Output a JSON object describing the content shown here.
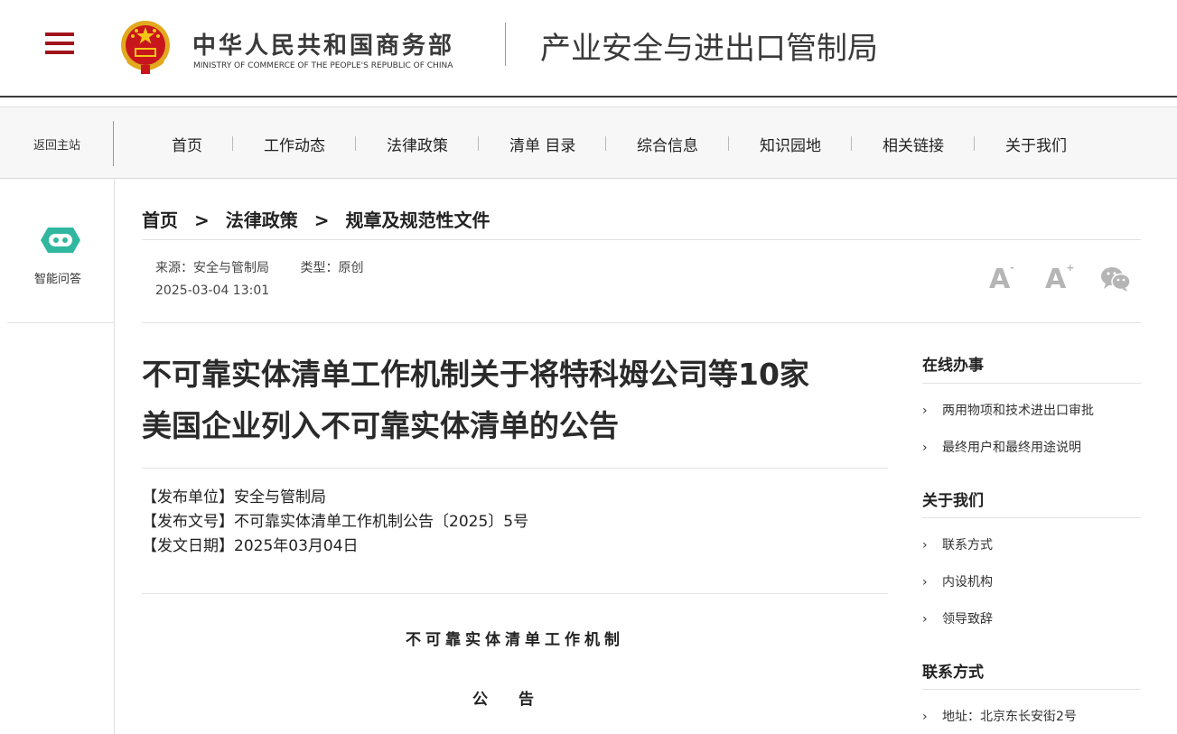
{
  "header": {
    "ministry_cn": "中华人民共和国商务部",
    "ministry_en": "MINISTRY OF COMMERCE OF THE PEOPLE'S REPUBLIC OF CHINA",
    "bureau": "产业安全与进出口管制局"
  },
  "nav": {
    "home": "返回主站",
    "items": [
      "首页",
      "工作动态",
      "法律政策",
      "清单 目录",
      "综合信息",
      "知识园地",
      "相关链接",
      "关于我们"
    ]
  },
  "side": {
    "qa_label": "智能问答"
  },
  "breadcrumb": {
    "items": [
      "首页",
      "法律政策",
      "规章及规范性文件"
    ],
    "separator": ">"
  },
  "meta": {
    "source": "来源：安全与管制局",
    "type": "类型：原创",
    "date": "2025-03-04 13:01"
  },
  "tools": {
    "font_smaller": "A",
    "font_smaller_sup": "-",
    "font_larger": "A",
    "font_larger_sup": "+"
  },
  "article": {
    "title_line1": "不可靠实体清单工作机制关于将特科姆公司等10家",
    "title_line2": "美国企业列入不可靠实体清单的公告",
    "publisher": "【发布单位】安全与管制局",
    "doc_number": "【发布文号】不可靠实体清单工作机制公告〔2025〕5号",
    "issue_date": "【发文日期】2025年03月04日",
    "org_heading": "不可靠实体清单工作机制",
    "notice_heading": "公　　告"
  },
  "right": {
    "sections": [
      {
        "title": "在线办事",
        "items": [
          "两用物项和技术进出口审批",
          "最终用户和最终用途说明"
        ]
      },
      {
        "title": "关于我们",
        "items": [
          "联系方式",
          "内设机构",
          "领导致辞"
        ]
      },
      {
        "title": "联系方式",
        "items": [
          "地址：北京东长安街2号"
        ]
      }
    ]
  },
  "colors": {
    "brand_red": "#a0141b",
    "qa_teal": "#2fb7a0"
  }
}
